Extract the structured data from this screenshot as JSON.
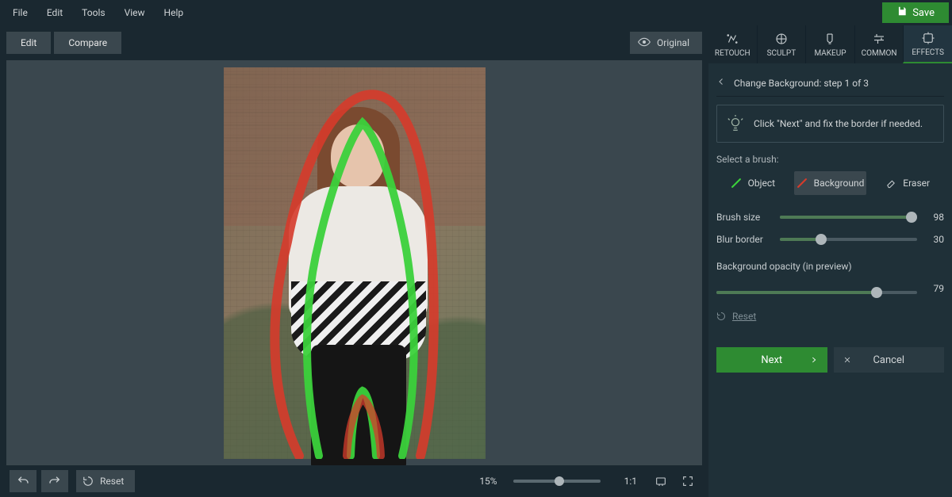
{
  "menu": {
    "file": "File",
    "edit": "Edit",
    "tools": "Tools",
    "view": "View",
    "help": "Help"
  },
  "save_label": "Save",
  "toolbar": {
    "edit": "Edit",
    "compare": "Compare",
    "original": "Original"
  },
  "tabs": {
    "retouch": "RETOUCH",
    "sculpt": "SCULPT",
    "makeup": "MAKEUP",
    "common": "COMMON",
    "effects": "EFFECTS"
  },
  "crumb": "Change Background: step 1 of 3",
  "hint": "Click \"Next\" and fix the border if needed.",
  "brush": {
    "section_label": "Select a brush:",
    "object": "Object",
    "background": "Background",
    "eraser": "Eraser"
  },
  "sliders": {
    "brush_size": {
      "label": "Brush size",
      "value": "98",
      "pct": 96
    },
    "blur_border": {
      "label": "Blur border",
      "value": "30",
      "pct": 30
    },
    "opacity_label": "Background opacity (in preview)",
    "opacity": {
      "value": "79",
      "pct": 80
    }
  },
  "reset": "Reset",
  "actions": {
    "next": "Next",
    "cancel": "Cancel"
  },
  "bottom": {
    "reset": "Reset",
    "zoom": "15%",
    "ratio": "1:1"
  }
}
